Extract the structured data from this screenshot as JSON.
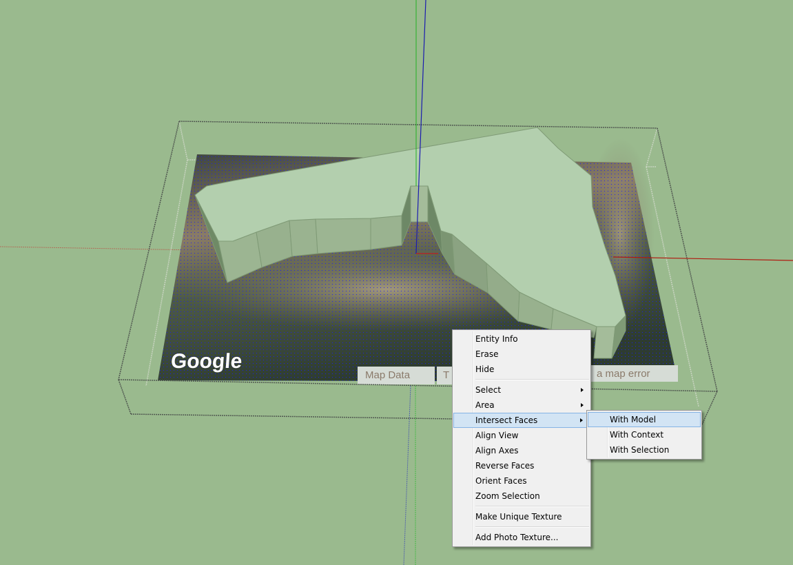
{
  "viewport": {
    "background_color": "#9aba8e",
    "axes": {
      "red": "#b01a10",
      "green": "#22b022",
      "blue": "#1010b0"
    },
    "terrain": {
      "logo": "Google",
      "attribution": [
        "Map Data",
        "T",
        "a map error"
      ]
    },
    "model_top_color": "#b3cfae",
    "model_side_color": "#9cb592"
  },
  "context_menu": {
    "items": [
      {
        "label": "Entity Info"
      },
      {
        "label": "Erase"
      },
      {
        "label": "Hide"
      },
      {
        "separator": true
      },
      {
        "label": "Select",
        "submenu": true
      },
      {
        "label": "Area",
        "submenu": true
      },
      {
        "label": "Intersect Faces",
        "submenu": true,
        "highlighted": true
      },
      {
        "label": "Align View"
      },
      {
        "label": "Align Axes"
      },
      {
        "label": "Reverse Faces"
      },
      {
        "label": "Orient Faces"
      },
      {
        "label": "Zoom Selection"
      },
      {
        "separator": true
      },
      {
        "label": "Make Unique Texture"
      },
      {
        "separator": true
      },
      {
        "label": "Add Photo Texture..."
      }
    ]
  },
  "submenu": {
    "parent": "Intersect Faces",
    "items": [
      {
        "label": "With Model",
        "highlighted": true
      },
      {
        "label": "With Context"
      },
      {
        "label": "With Selection"
      }
    ]
  }
}
